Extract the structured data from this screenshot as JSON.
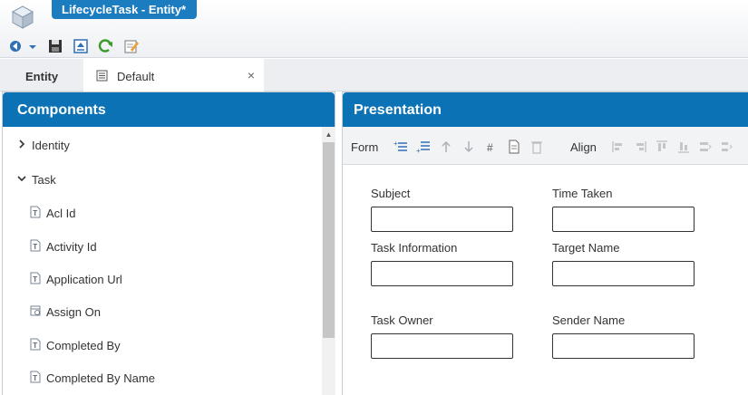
{
  "window": {
    "title": "LifecycleTask - Entity*"
  },
  "quick_toolbar": [
    {
      "icon": "back-dropdown-icon"
    },
    {
      "icon": "save-icon"
    },
    {
      "icon": "export-icon"
    },
    {
      "icon": "refresh-icon"
    },
    {
      "icon": "edit-icon"
    }
  ],
  "tabs": {
    "entity": "Entity",
    "default": "Default",
    "close": "×"
  },
  "components": {
    "title": "Components",
    "items": [
      {
        "label": "Identity",
        "type": "group",
        "expanded": false
      },
      {
        "label": "Task",
        "type": "group",
        "expanded": true
      },
      {
        "label": "Acl Id",
        "type": "text-field"
      },
      {
        "label": "Activity Id",
        "type": "text-field"
      },
      {
        "label": "Application Url",
        "type": "text-field"
      },
      {
        "label": "Assign On",
        "type": "date-field"
      },
      {
        "label": "Completed By",
        "type": "text-field"
      },
      {
        "label": "Completed By Name",
        "type": "text-field"
      }
    ]
  },
  "presentation": {
    "title": "Presentation",
    "toolbar": {
      "form_label": "Form",
      "align_label": "Align"
    },
    "fields": [
      {
        "label": "Subject",
        "value": ""
      },
      {
        "label": "Time Taken",
        "value": ""
      },
      {
        "label": "Task Information",
        "value": ""
      },
      {
        "label": "Target Name",
        "value": ""
      },
      {
        "label": "Task Owner",
        "value": ""
      },
      {
        "label": "Sender Name",
        "value": ""
      }
    ]
  },
  "colors": {
    "accent": "#0b72b5",
    "title_tab": "#1c7cc0"
  }
}
